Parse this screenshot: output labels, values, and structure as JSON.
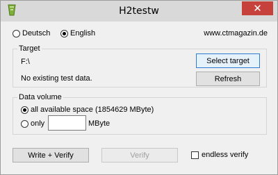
{
  "window": {
    "title": "H2testw",
    "close_glyph": "✕",
    "icon": "h2testw-app-icon",
    "close_color": "#c7413c"
  },
  "language": {
    "options": [
      {
        "label": "Deutsch",
        "selected": false
      },
      {
        "label": "English",
        "selected": true
      }
    ],
    "website": "www.ctmagazin.de"
  },
  "target": {
    "legend": "Target",
    "path": "F:\\",
    "status": "No existing test data.",
    "select_button": "Select target",
    "refresh_button": "Refresh"
  },
  "data_volume": {
    "legend": "Data volume",
    "all_space_label": "all available space (1854629 MByte)",
    "all_space_selected": true,
    "only_label": "only",
    "only_selected": false,
    "only_value": "",
    "unit": "MByte"
  },
  "actions": {
    "write_verify": "Write + Verify",
    "verify": "Verify",
    "endless_verify": "endless verify",
    "endless_checked": false
  }
}
